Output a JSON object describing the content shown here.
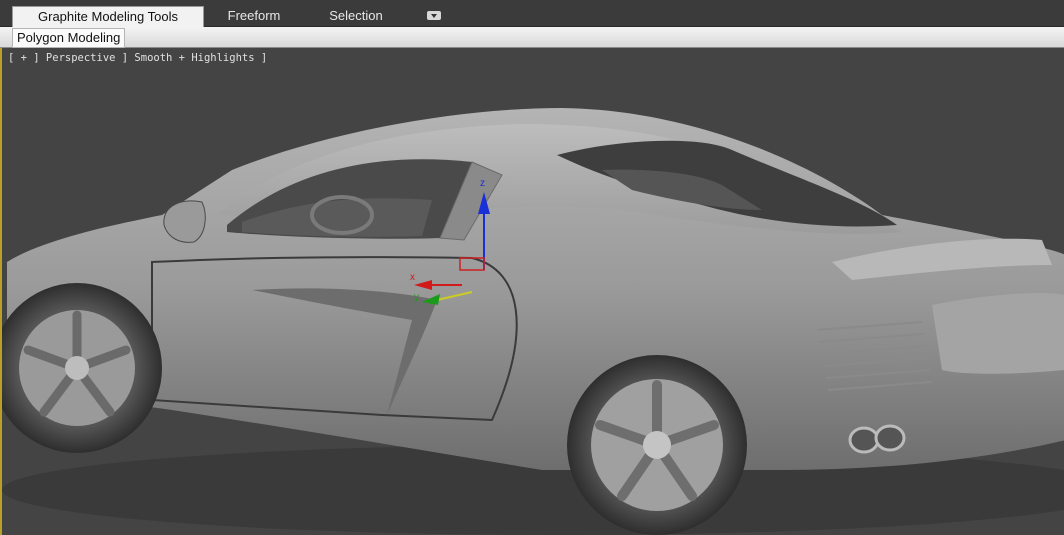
{
  "ribbon": {
    "tabs": [
      {
        "label": "Graphite Modeling Tools",
        "active": true
      },
      {
        "label": "Freeform",
        "active": false
      },
      {
        "label": "Selection",
        "active": false
      }
    ],
    "dropdown_icon": "chevron-down-icon",
    "panel_label": "Polygon Modeling"
  },
  "viewport": {
    "label": "[ + ] Perspective ] Smooth + Highlights ]",
    "gizmo": {
      "x_label": "x",
      "y_label": "y",
      "z_label": "z"
    },
    "colors": {
      "active_border": "#b8a02a",
      "background": "#444444",
      "x_axis": "#d21a1a",
      "y_axis": "#1c9a1c",
      "z_axis": "#1a2fd6"
    }
  }
}
